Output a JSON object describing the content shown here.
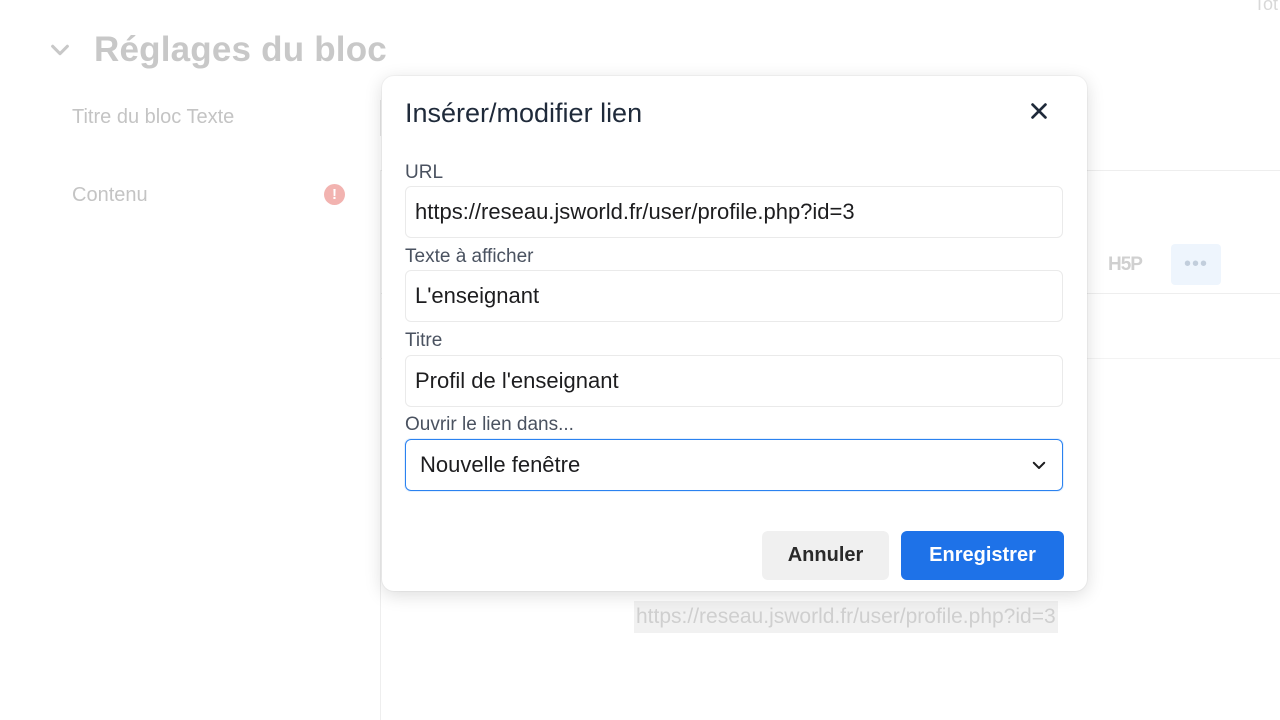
{
  "background": {
    "corner_text": "Tot",
    "section_title": "Réglages du bloc",
    "fields": {
      "block_title_label": "Titre du bloc Texte",
      "content_label": "Contenu",
      "warning_glyph": "!"
    },
    "toolbar": {
      "h5p_label": "H5P",
      "more_label": "•••"
    },
    "link_preview": "https://reseau.jsworld.fr/user/profile.php?id=3"
  },
  "modal": {
    "title": "Insérer/modifier lien",
    "url": {
      "label": "URL",
      "value": "https://reseau.jsworld.fr/user/profile.php?id=3"
    },
    "text_to_display": {
      "label": "Texte à afficher",
      "value": "L'enseignant"
    },
    "title_field": {
      "label": "Titre",
      "value": "Profil de l'enseignant"
    },
    "open_in": {
      "label": "Ouvrir le lien dans...",
      "selected": "Nouvelle fenêtre"
    },
    "buttons": {
      "cancel": "Annuler",
      "save": "Enregistrer"
    }
  },
  "colors": {
    "primary": "#1e72e8",
    "focus_border": "#2b82f0",
    "warning": "#f2b3b0",
    "title_text": "#1f2a3a"
  },
  "icons": {
    "section_toggle": "chevron-down-icon",
    "close": "close-icon",
    "warning": "exclamation-circle-icon",
    "select_toggle": "chevron-down-icon"
  }
}
